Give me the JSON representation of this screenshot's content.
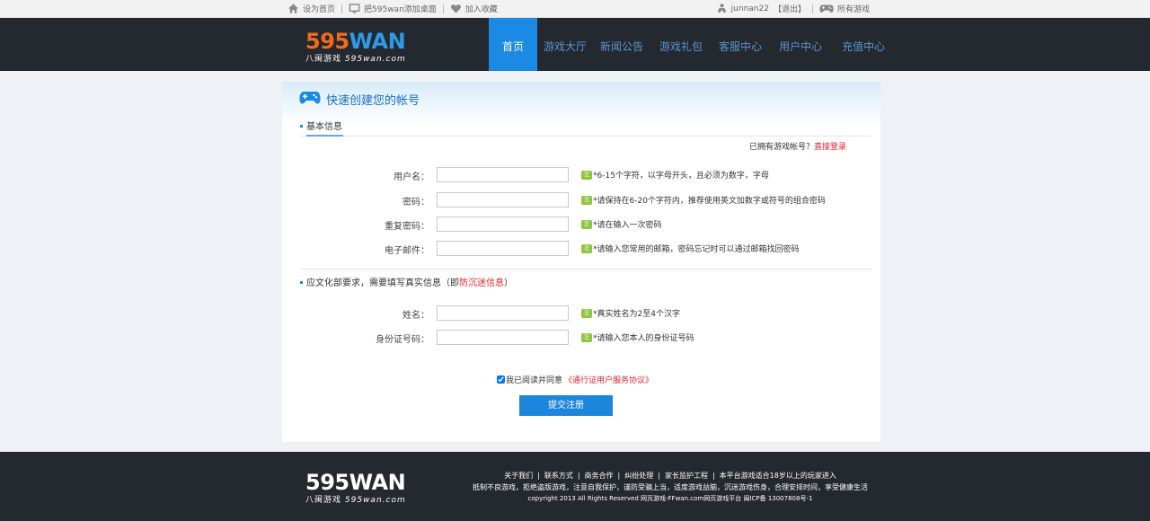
{
  "topbar": {
    "set_home": "设为首页",
    "add_desktop": "把595wan添加桌面",
    "add_favorite": "加入收藏",
    "username": "junnan22",
    "logout": "【退出】",
    "all_games": "所有游戏"
  },
  "header": {
    "logo": {
      "digits": "595",
      "word": "WAN",
      "tag_cn": "八闽游戏",
      "tag_url": "595wan.com"
    },
    "nav": [
      "首页",
      "游戏大厅",
      "新闻公告",
      "游戏礼包",
      "客服中心",
      "用户中心",
      "充值中心"
    ]
  },
  "panel": {
    "title": "快速创建您的帐号",
    "section1": "基本信息",
    "has_account": "已拥有游戏帐号？",
    "login_link": "直接登录",
    "tip_tag": "注",
    "fields": [
      {
        "label": "用户名：",
        "tip": "*6-15个字符，以字母开头，且必须为数字，字母"
      },
      {
        "label": "密码：",
        "tip": "*请保持在6-20个字符内，推荐使用英文加数字或符号的组合密码"
      },
      {
        "label": "重复密码：",
        "tip": "*请在输入一次密码"
      },
      {
        "label": "电子邮件：",
        "tip": "*请输入您常用的邮箱，密码忘记时可以通过邮箱找回密码"
      }
    ],
    "section2_prefix": "应文化部要求，需要填写真实信息（即",
    "section2_link": "防沉迷信息",
    "section2_suffix": "）",
    "fields2": [
      {
        "label": "姓名：",
        "tip": "*真实姓名为2至4个汉字"
      },
      {
        "label": "身份证号码：",
        "tip": "*请输入您本人的身份证号码"
      }
    ],
    "agree_text": "我已阅读并同意",
    "agree_link": "《通行证用户服务协议》",
    "submit": "提交注册"
  },
  "footer": {
    "logo": {
      "text": "595WAN",
      "tag_cn": "八闽游戏",
      "tag_url": "595wan.com"
    },
    "links": [
      "关于我们",
      "联系方式",
      "商务合作",
      "纠纷处理",
      "家长监护工程",
      "本平台游戏适合18岁以上的玩家进入"
    ],
    "health": "抵制不良游戏，拒绝盗版游戏，注意自我保护，谨防受骗上当，适度游戏益脑，沉迷游戏伤身，合理安排时间，享受健康生活",
    "copyright": "copyright 2013 All Rights Reserved 网页游戏-FFwan.com网页游戏平台 闽ICP备 13007808号-1"
  },
  "colors": {
    "accent": "#1a8ae5",
    "header_bg": "#24282f",
    "logo_orange": "#f26b1d",
    "link_red": "#e0262f",
    "tip_green": "#8fc63f"
  }
}
